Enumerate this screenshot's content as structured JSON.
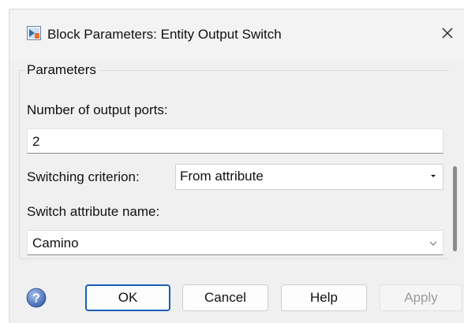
{
  "window": {
    "title": "Block Parameters: Entity Output Switch"
  },
  "parameters": {
    "group_label": "Parameters",
    "num_ports_label": "Number of output ports:",
    "num_ports_value": "2",
    "criterion_label": "Switching criterion:",
    "criterion_value": "From attribute",
    "attr_name_label": "Switch attribute name:",
    "attr_name_value": "Camino"
  },
  "buttons": {
    "ok": "OK",
    "cancel": "Cancel",
    "help": "Help",
    "apply": "Apply"
  },
  "icons": {
    "app": "matlab-block-icon",
    "close": "close-icon",
    "help": "help-question-icon",
    "dropdown": "chevron-down-icon"
  },
  "colors": {
    "window_bg": "#f0f0f0",
    "default_button_border": "#1a5fb4",
    "disabled_text": "#9b9b9b",
    "help_icon": "#4a6fb5"
  }
}
